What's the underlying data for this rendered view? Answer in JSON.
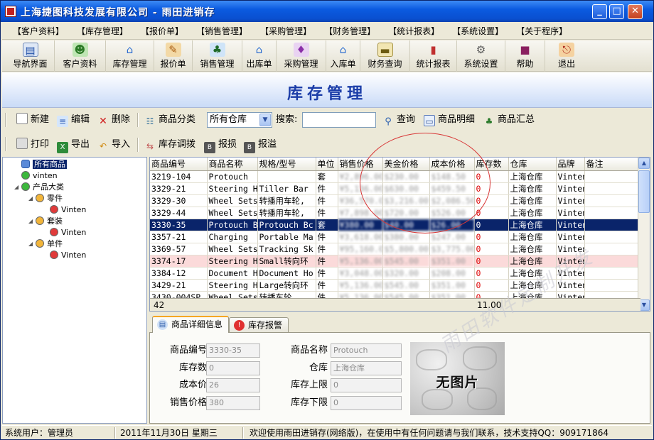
{
  "window": {
    "title": "上海捷图科技发展有限公司 - 雨田进销存"
  },
  "menu": [
    "【客户资料】",
    "【库存管理】",
    "【报价单】",
    "【销售管理】",
    "【采购管理】",
    "【财务管理】",
    "【统计报表】",
    "【系统设置】",
    "【关于程序】"
  ],
  "toolbar": [
    {
      "label": "导航界面",
      "icon": "navigation-icon"
    },
    {
      "label": "客户资料",
      "icon": "customers-icon"
    },
    {
      "label": "库存管理",
      "icon": "inventory-icon"
    },
    {
      "label": "报价单",
      "icon": "quotation-icon"
    },
    {
      "label": "销售管理",
      "icon": "sales-icon"
    },
    {
      "label": "出库单",
      "icon": "outbound-icon"
    },
    {
      "label": "采购管理",
      "icon": "purchase-icon"
    },
    {
      "label": "入库单",
      "icon": "inbound-icon"
    },
    {
      "label": "财务查询",
      "icon": "finance-icon"
    },
    {
      "label": "统计报表",
      "icon": "report-icon"
    },
    {
      "label": "系统设置",
      "icon": "settings-icon"
    },
    {
      "label": "帮助",
      "icon": "help-book-icon"
    },
    {
      "label": "退出",
      "icon": "exit-icon"
    }
  ],
  "header": {
    "title": "库存管理"
  },
  "actions": {
    "new": "新建",
    "edit": "编辑",
    "delete": "删除",
    "category": "商品分类",
    "warehouse_selected": "所有仓库",
    "search_label": "搜索:",
    "search_value": "",
    "query": "查询",
    "detail": "商品明细",
    "summary": "商品汇总",
    "print": "打印",
    "export": "导出",
    "import": "导入",
    "transfer": "库存调拨",
    "loss": "报损",
    "overflow": "报溢"
  },
  "tree": {
    "root": "所有商品",
    "child1": "vinten",
    "group": "产品大类",
    "sub1": "零件",
    "sub1_leaf": "Vinten",
    "sub2": "套装",
    "sub2_leaf": "Vinten",
    "sub3": "单件",
    "sub3_leaf": "Vinten"
  },
  "grid": {
    "columns": [
      "商品编号",
      "商品名称",
      "规格/型号",
      "单位",
      "销售价格",
      "美金价格",
      "成本价格",
      "库存数",
      "仓库",
      "品牌",
      "备注"
    ],
    "rows": [
      [
        "3219-104",
        "Protouch",
        "",
        "套",
        "¥2,896.00",
        "$230.00",
        "$148.50",
        "0",
        "上海仓库",
        "Vinten",
        ""
      ],
      [
        "3329-21",
        "Steering Ha",
        "Tiller Bar",
        "件",
        "¥5,136.00",
        "$630.00",
        "$459.50",
        "0",
        "上海仓库",
        "Vinten",
        ""
      ],
      [
        "3329-30",
        "Wheel Sets",
        "转播用车轮,",
        "件",
        "¥36,570.00",
        "$3,216.00",
        "$2,086.50",
        "0",
        "上海仓库",
        "Vinten",
        ""
      ],
      [
        "3329-44",
        "Wheel Sets",
        "转播用车轮,",
        "件",
        "¥7,898.00",
        "$720.00",
        "$526.00",
        "0",
        "上海仓库",
        "Vinten",
        ""
      ],
      [
        "3330-35",
        "Protouch Bc",
        "Protouch Bc",
        "套",
        "¥380.00",
        "$40.00",
        "$26.00",
        "0",
        "上海仓库",
        "Vinten",
        ""
      ],
      [
        "3357-21",
        "Charging",
        "Portable Ma",
        "件",
        "¥3,618.00",
        "$380.00",
        "$247.00",
        "0",
        "上海仓库",
        "Vinten",
        ""
      ],
      [
        "3369-57",
        "Wheel Sets",
        "Tracking Sk",
        "件",
        "¥95,160.00",
        "$5,800.00",
        "$3,775.00",
        "0",
        "上海仓库",
        "Vinten",
        ""
      ],
      [
        "3374-17",
        "Steering Ha",
        "Small转向环",
        "件",
        "¥5,136.00",
        "$545.00",
        "$351.00",
        "0",
        "上海仓库",
        "Vinten",
        ""
      ],
      [
        "3384-12",
        "Document Ho",
        "Document Ho",
        "件",
        "¥3,048.00",
        "$320.00",
        "$208.00",
        "0",
        "上海仓库",
        "Vinten",
        ""
      ],
      [
        "3429-21",
        "Steering Ha",
        "Large转向环",
        "件",
        "¥5,136.00",
        "$545.00",
        "$351.00",
        "0",
        "上海仓库",
        "Vinten",
        ""
      ],
      [
        "3430-004SP",
        "Wheel Sets",
        "转播车轮,",
        "件",
        "¥5,136.00",
        "$545.00",
        "$351.00",
        "0",
        "上海仓库",
        "Vinten",
        ""
      ]
    ],
    "footer_count": "42",
    "footer_stock": "11.00"
  },
  "tabs": {
    "detail": "商品详细信息",
    "alert": "库存报警"
  },
  "detail": {
    "code_label": "商品编号",
    "code": "3330-35",
    "name_label": "商品名称",
    "name": "Protouch",
    "stock_label": "库存数",
    "stock": "0",
    "warehouse_label": "仓库",
    "warehouse": "上海仓库",
    "cost_label": "成本价",
    "cost": "26",
    "upper_label": "库存上限",
    "upper": "0",
    "price_label": "销售价格",
    "price": "380",
    "lower_label": "库存下限",
    "lower": "0",
    "noimage": "无图片"
  },
  "watermark": "雨田软件定制开发",
  "status": {
    "user": "系统用户：管理员",
    "date": "2011年11月30日 星期三",
    "message": "欢迎使用雨田进销存(网络版)，在使用中有任何问题请与我们联系，技术支持QQ：909171864"
  }
}
